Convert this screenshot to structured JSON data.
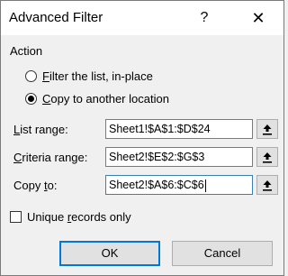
{
  "window": {
    "title": "Advanced Filter",
    "help_glyph": "?",
    "close_glyph": "✕"
  },
  "action": {
    "group_label": "Action",
    "options": [
      {
        "mnemonic": "F",
        "rest": "ilter the list, in-place",
        "checked": false
      },
      {
        "mnemonic": "C",
        "rest": "opy to another location",
        "checked": true
      }
    ]
  },
  "fields": [
    {
      "label_pre": "",
      "mnemonic": "L",
      "label_post": "ist range:",
      "value": "Sheet1!$A$1:$D$24",
      "focused": false
    },
    {
      "label_pre": "",
      "mnemonic": "C",
      "label_post": "riteria range:",
      "value": "Sheet2!$E$2:$G$3",
      "focused": false
    },
    {
      "label_pre": "Copy ",
      "mnemonic": "t",
      "label_post": "o:",
      "value": "Sheet2!$A$6:$C$6",
      "focused": true
    }
  ],
  "unique": {
    "pre": "Unique ",
    "mnemonic": "r",
    "post": "ecords only",
    "checked": false
  },
  "buttons": {
    "ok": "OK",
    "cancel": "Cancel"
  },
  "icons": {
    "ref_button": "collapse-dialog-icon"
  }
}
